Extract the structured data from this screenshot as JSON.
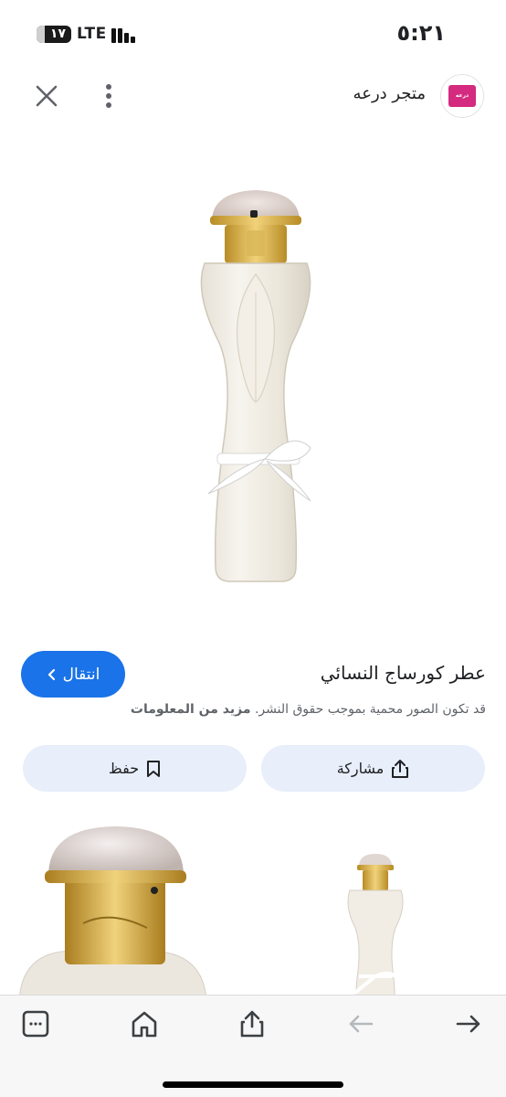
{
  "status_bar": {
    "time": "٥:٢١",
    "battery": "١٧",
    "network": "LTE"
  },
  "header": {
    "site_name": "متجر درعه",
    "logo_text": "درعه",
    "close_icon": "close-icon",
    "more_icon": "more-vert-icon"
  },
  "product": {
    "title": "عطر كورساج النسائي",
    "visit_label": "انتقال",
    "copyright_text": "قد تكون الصور محمية بموجب حقوق النشر.",
    "more_info_label": "مزيد من المعلومات"
  },
  "actions": {
    "share_label": "مشاركة",
    "save_label": "حفظ"
  },
  "toolbar": {
    "items": [
      "tabs-icon",
      "home-icon",
      "share-icon",
      "back-icon",
      "forward-icon"
    ]
  },
  "colors": {
    "accent": "#1a73e8",
    "button_bg": "#e8eefa",
    "gold": "#c9a43a"
  }
}
